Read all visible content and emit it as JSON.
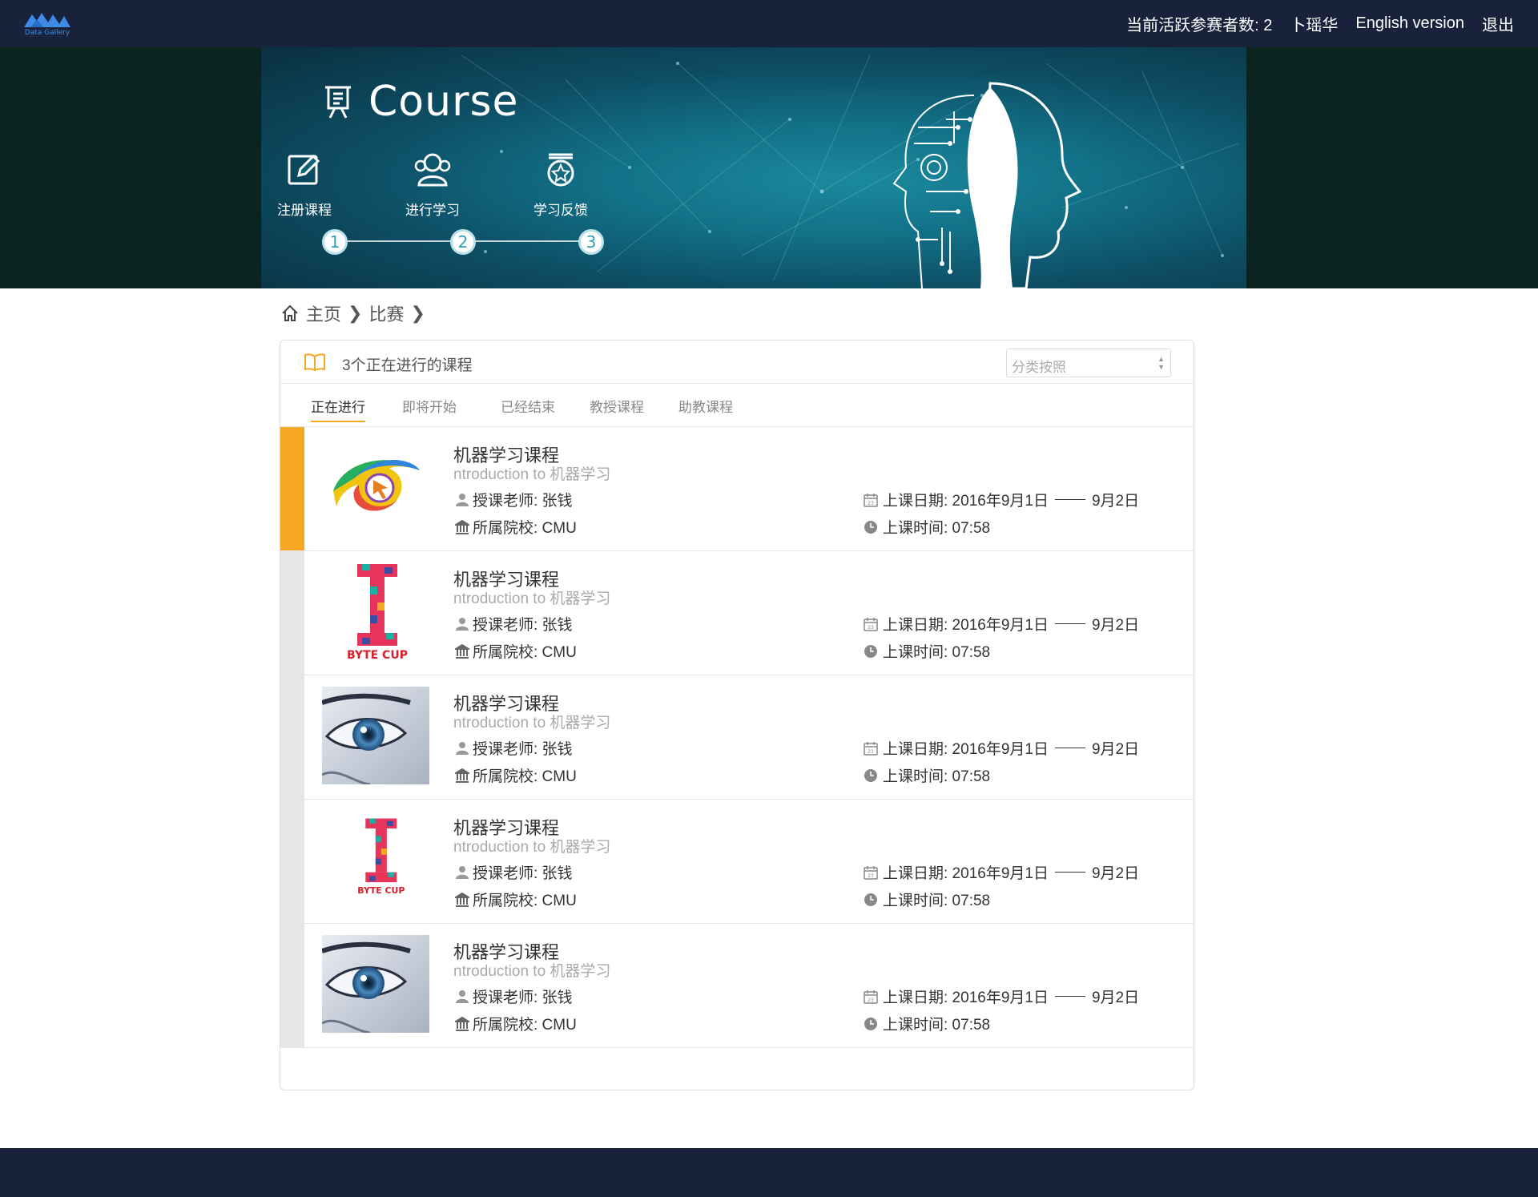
{
  "brand": {
    "logo_text": "Data Gallery"
  },
  "topnav": {
    "active_count": "当前活跃参赛者数: 2",
    "user": "卜瑶华",
    "language": "English version",
    "logout": "退出"
  },
  "banner": {
    "title": "Course",
    "steps": [
      {
        "label": "注册课程",
        "num": "1"
      },
      {
        "label": "进行学习",
        "num": "2"
      },
      {
        "label": "学习反馈",
        "num": "3"
      }
    ]
  },
  "breadcrumb": {
    "home": "主页",
    "current": "比赛"
  },
  "panel": {
    "count_label": "3个正在进行的课程",
    "sort_placeholder": "分类按照",
    "tabs": [
      "正在进行",
      "即将开始",
      "已经结束",
      "教授课程",
      "助教课程"
    ]
  },
  "courses": [
    {
      "title": "机器学习课程",
      "subtitle": "ntroduction to 机器学习",
      "teacher": "授课老师: 张钱",
      "school": "所属院校: CMU",
      "date_start": "上课日期: 2016年9月1日",
      "date_end": "9月2日",
      "time": "上课时间:  07:58",
      "thumb": "eye-logo",
      "active": true
    },
    {
      "title": "机器学习课程",
      "subtitle": "ntroduction to 机器学习",
      "teacher": "授课老师: 张钱",
      "school": "所属院校: CMU",
      "date_start": "上课日期: 2016年9月1日",
      "date_end": "9月2日",
      "time": "上课时间:  07:58",
      "thumb": "byte-cup",
      "byte_text": "BYTE CUP",
      "active": false
    },
    {
      "title": "机器学习课程",
      "subtitle": "ntroduction to 机器学习",
      "teacher": "授课老师: 张钱",
      "school": "所属院校: CMU",
      "date_start": "上课日期: 2016年9月1日",
      "date_end": "9月2日",
      "time": "上课时间:  07:58",
      "thumb": "eye-photo",
      "active": false
    },
    {
      "title": "机器学习课程",
      "subtitle": "ntroduction to 机器学习",
      "teacher": "授课老师: 张钱",
      "school": "所属院校: CMU",
      "date_start": "上课日期: 2016年9月1日",
      "date_end": "9月2日",
      "time": "上课时间:  07:58",
      "thumb": "byte-cup",
      "byte_text": "BYTE CUP",
      "active": false
    },
    {
      "title": "机器学习课程",
      "subtitle": "ntroduction to 机器学习",
      "teacher": "授课老师: 张钱",
      "school": "所属院校: CMU",
      "date_start": "上课日期: 2016年9月1日",
      "date_end": "9月2日",
      "time": "上课时间:  07:58",
      "thumb": "eye-photo",
      "active": false
    }
  ],
  "colors": {
    "nav_bg": "#18223a",
    "accent": "#f5a623",
    "step_circle": "#2ea0b3"
  }
}
